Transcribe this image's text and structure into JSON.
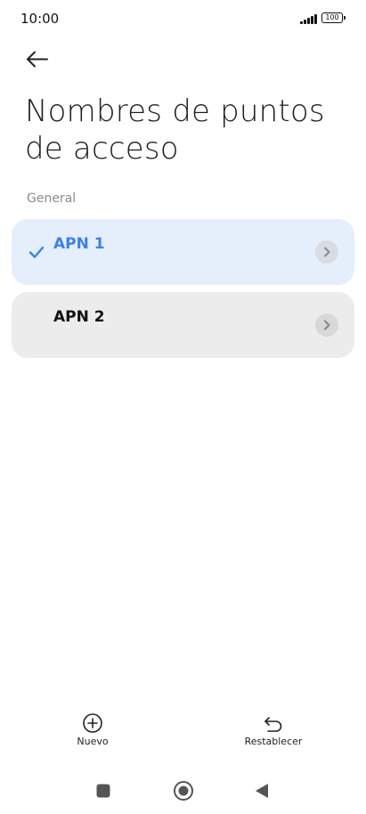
{
  "status_bar": {
    "time": "10:00",
    "battery": "100"
  },
  "header": {
    "back_icon": "arrow-left-icon",
    "title": "Nombres de puntos de acceso"
  },
  "section": {
    "label": "General"
  },
  "apns": [
    {
      "label": "APN 1",
      "selected": true
    },
    {
      "label": "APN 2",
      "selected": false
    }
  ],
  "actions": {
    "new_label": "Nuevo",
    "reset_label": "Restablecer"
  },
  "colors": {
    "accent": "#3a82e6",
    "selected_card": "#e5eefb",
    "card": "#ececec"
  }
}
